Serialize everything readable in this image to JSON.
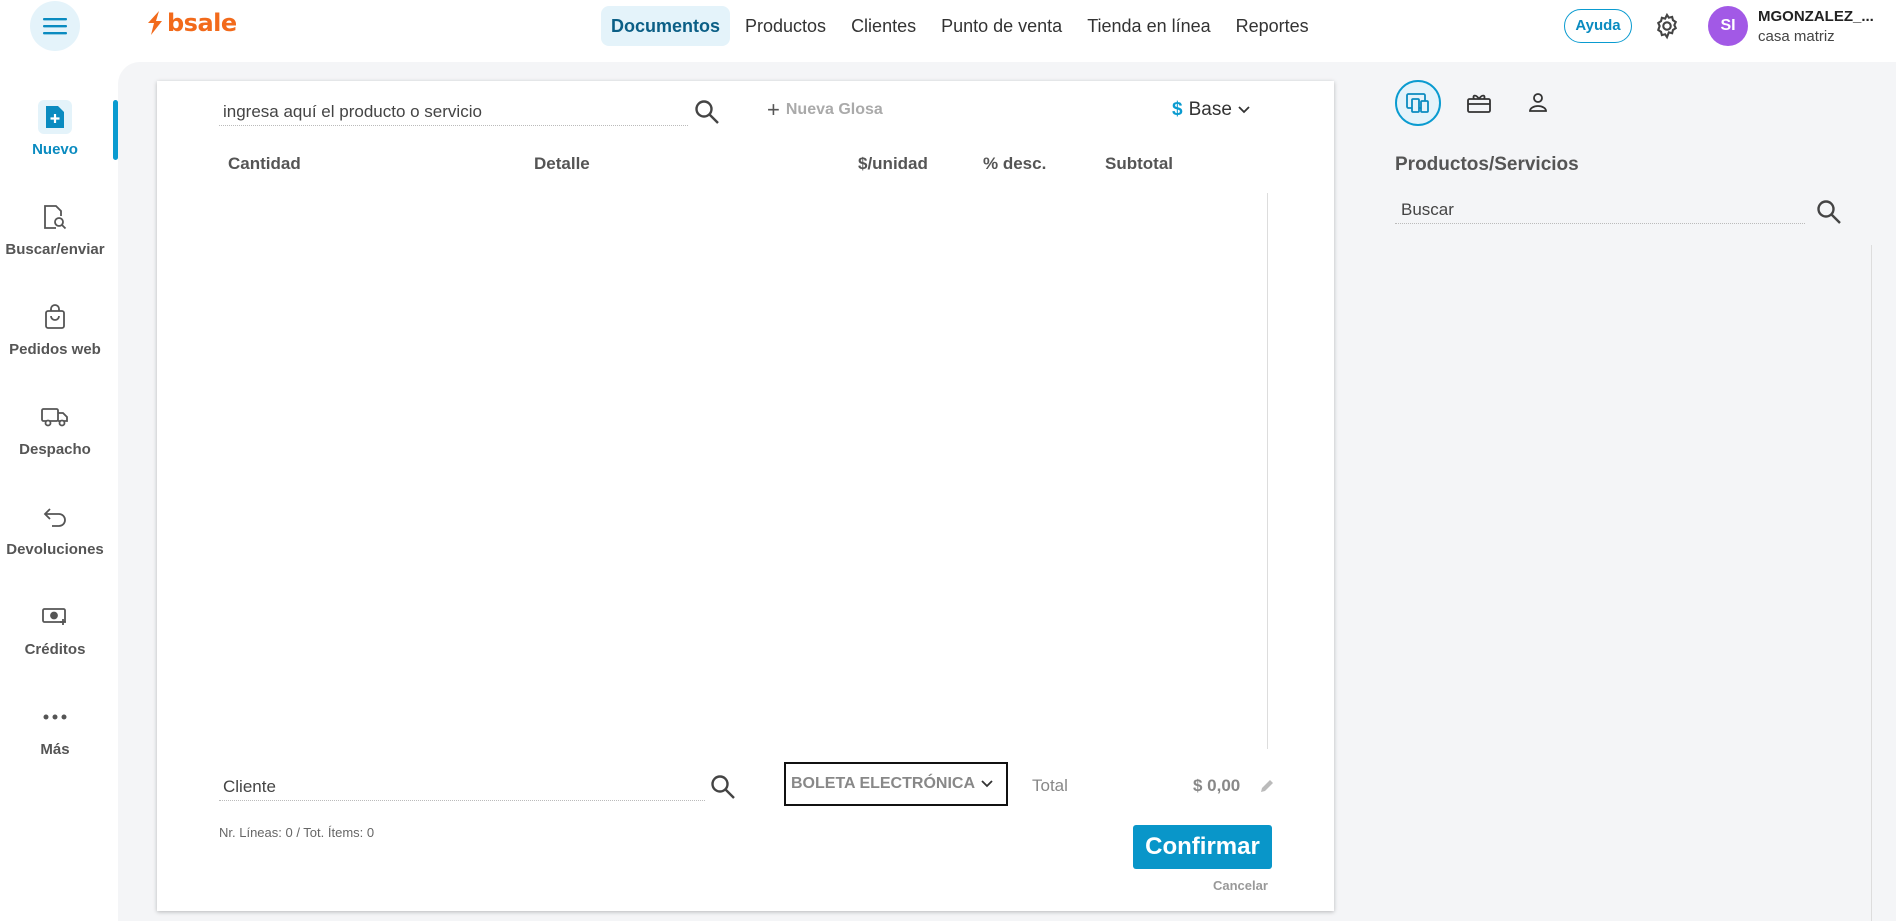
{
  "header": {
    "logo_text": "bsale",
    "nav": [
      {
        "label": "Documentos",
        "active": true
      },
      {
        "label": "Productos",
        "active": false
      },
      {
        "label": "Clientes",
        "active": false
      },
      {
        "label": "Punto de venta",
        "active": false
      },
      {
        "label": "Tienda en línea",
        "active": false
      },
      {
        "label": "Reportes",
        "active": false
      }
    ],
    "help_label": "Ayuda",
    "avatar_initials": "SI",
    "user_name": "MGONZALEZ_...",
    "user_branch": "casa matriz",
    "accent_color": "#0a9bd0",
    "brand_color": "#f26a1b"
  },
  "sidebar": {
    "items": [
      {
        "label": "Nuevo",
        "icon": "new-document-icon",
        "active": true
      },
      {
        "label": "Buscar/enviar",
        "icon": "search-document-icon",
        "active": false
      },
      {
        "label": "Pedidos web",
        "icon": "shopping-bag-icon",
        "active": false
      },
      {
        "label": "Despacho",
        "icon": "truck-icon",
        "active": false
      },
      {
        "label": "Devoluciones",
        "icon": "return-arrow-icon",
        "active": false
      },
      {
        "label": "Créditos",
        "icon": "money-icon",
        "active": false
      },
      {
        "label": "Más",
        "icon": "more-dots-icon",
        "active": false
      }
    ]
  },
  "document": {
    "product_search_value": "ingresa aquí el producto o servicio",
    "new_gloss_label": "Nueva Glosa",
    "currency_symbol": "$",
    "price_list_label": "Base",
    "columns": [
      "Cantidad",
      "Detalle",
      "$/unidad",
      "% desc.",
      "Subtotal"
    ],
    "client_value": "Cliente",
    "document_type": "BOLETA ELECTRÓNICA",
    "total_label": "Total",
    "total_value": "$ 0,00",
    "lines_info": "Nr. Líneas: 0 / Tot. Ítems: 0",
    "confirm_label": "Confirmar",
    "cancel_label": "Cancelar"
  },
  "right_panel": {
    "tabs": [
      "devices-icon",
      "gift-card-icon",
      "person-icon"
    ],
    "title": "Productos/Servicios",
    "search_value": "Buscar"
  }
}
